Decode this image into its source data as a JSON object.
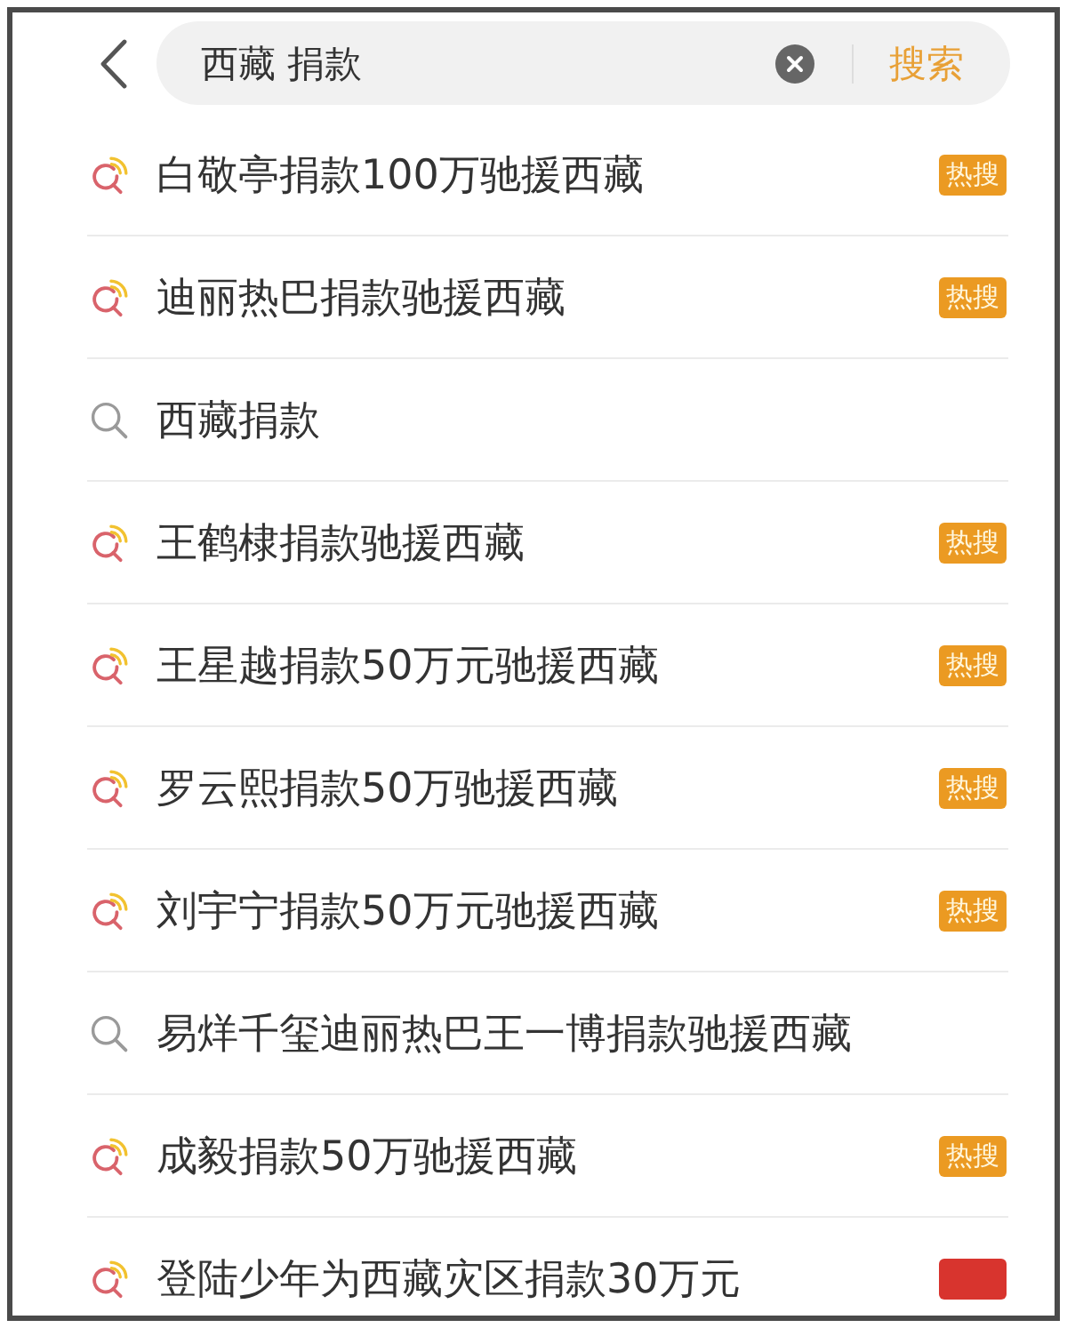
{
  "search_bar": {
    "value": "西藏 捐款",
    "button": "搜索"
  },
  "suggestions": [
    {
      "kind": "trending",
      "text": "白敬亭捐款100万驰援西藏",
      "badge": {
        "text": "热搜",
        "color": "#eb9a22"
      }
    },
    {
      "kind": "trending",
      "text": "迪丽热巴捐款驰援西藏",
      "badge": {
        "text": "热搜",
        "color": "#eb9a22"
      }
    },
    {
      "kind": "plain",
      "text": "西藏捐款"
    },
    {
      "kind": "trending",
      "text": "王鹤棣捐款驰援西藏",
      "badge": {
        "text": "热搜",
        "color": "#eb9a22"
      }
    },
    {
      "kind": "trending",
      "text": "王星越捐款50万元驰援西藏",
      "badge": {
        "text": "热搜",
        "color": "#eb9a22"
      }
    },
    {
      "kind": "trending",
      "text": "罗云熙捐款50万驰援西藏",
      "badge": {
        "text": "热搜",
        "color": "#eb9a22"
      }
    },
    {
      "kind": "trending",
      "text": "刘宇宁捐款50万元驰援西藏",
      "badge": {
        "text": "热搜",
        "color": "#eb9a22"
      }
    },
    {
      "kind": "plain",
      "text": "易烊千玺迪丽热巴王一博捐款驰援西藏"
    },
    {
      "kind": "trending",
      "text": "成毅捐款50万驰援西藏",
      "badge": {
        "text": "热搜",
        "color": "#eb9a22"
      }
    },
    {
      "kind": "trending",
      "text": "登陆少年为西藏灾区捐款30万元",
      "badge": {
        "color": "#d8342e"
      }
    }
  ]
}
